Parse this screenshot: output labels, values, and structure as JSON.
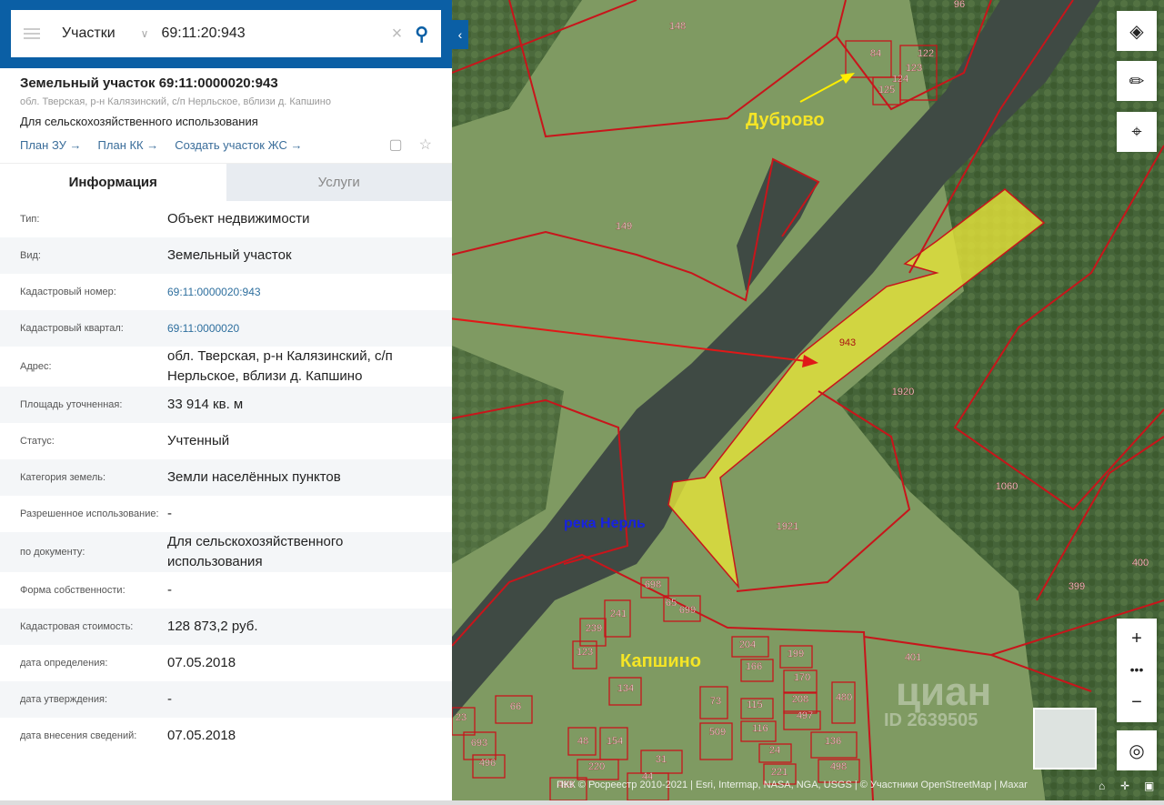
{
  "search": {
    "category": "Участки",
    "query": "69:11:20:943"
  },
  "object": {
    "title": "Земельный участок 69:11:0000020:943",
    "address": "обл. Тверская, р-н Калязинский, с/п Нерльское, вблизи д. Капшино",
    "purpose": "Для сельскохозяйственного использования",
    "links": [
      "План ЗУ →",
      "План КК →",
      "Создать участок ЖС →"
    ]
  },
  "tabs": [
    "Информация",
    "Услуги"
  ],
  "rows": [
    {
      "k": "Тип:",
      "v": "Объект недвижимости"
    },
    {
      "k": "Вид:",
      "v": "Земельный участок"
    },
    {
      "k": "Кадастровый номер:",
      "v": "69:11:0000020:943",
      "link": true
    },
    {
      "k": "Кадастровый квартал:",
      "v": "69:11:0000020",
      "link": true
    },
    {
      "k": "Адрес:",
      "v": "обл. Тверская, р-н Калязинский, с/п Нерльское, вблизи д. Капшино"
    },
    {
      "k": "Площадь уточненная:",
      "v": "33 914 кв. м"
    },
    {
      "k": "Статус:",
      "v": "Учтенный"
    },
    {
      "k": "Категория земель:",
      "v": "Земли населённых пунктов"
    },
    {
      "k": "Разрешенное использование:",
      "v": "-"
    },
    {
      "k": "по документу:",
      "v": "Для сельскохозяйственного использования"
    },
    {
      "k": "Форма собственности:",
      "v": "-"
    },
    {
      "k": "Кадастровая стоимость:",
      "v": "128 873,2 руб."
    },
    {
      "k": "дата определения:",
      "v": "07.05.2018"
    },
    {
      "k": "дата утверждения:",
      "v": "-"
    },
    {
      "k": "дата внесения сведений:",
      "v": "07.05.2018"
    }
  ],
  "map": {
    "labels": {
      "dubrovo": "Дуброво",
      "river": "река Нерль",
      "kapshino": "Капшино",
      "watermark": "циан",
      "watermark_id": "ID 2639505"
    },
    "parcels": [
      [
        "96",
        1055,
        8
      ],
      [
        "148",
        745,
        32
      ],
      [
        "84",
        963,
        62
      ],
      [
        "122",
        1018,
        62
      ],
      [
        "123",
        1005,
        78
      ],
      [
        "124",
        990,
        90
      ],
      [
        "125",
        975,
        102
      ],
      [
        "149",
        686,
        252
      ],
      [
        "943",
        932,
        380
      ],
      [
        "1920",
        993,
        434
      ],
      [
        "1060",
        1107,
        538
      ],
      [
        "1921",
        866,
        582
      ],
      [
        "400",
        1254,
        622
      ],
      [
        "399",
        1184,
        648
      ],
      [
        "401",
        1004,
        726
      ],
      [
        "698",
        718,
        646
      ],
      [
        "65",
        738,
        666
      ],
      [
        "699",
        756,
        674
      ],
      [
        "241",
        680,
        678
      ],
      [
        "239",
        653,
        694
      ],
      [
        "123",
        643,
        720
      ],
      [
        "204",
        822,
        712
      ],
      [
        "199",
        875,
        722
      ],
      [
        "166",
        829,
        736
      ],
      [
        "170",
        882,
        748
      ],
      [
        "208",
        880,
        772
      ],
      [
        "497",
        885,
        790
      ],
      [
        "115",
        830,
        778
      ],
      [
        "116",
        836,
        804
      ],
      [
        "24",
        852,
        828
      ],
      [
        "221",
        857,
        852
      ],
      [
        "136",
        916,
        818
      ],
      [
        "498",
        922,
        846
      ],
      [
        "480",
        928,
        770
      ],
      [
        "73",
        787,
        774
      ],
      [
        "509",
        789,
        808
      ],
      [
        "134",
        688,
        760
      ],
      [
        "66",
        567,
        780
      ],
      [
        "23",
        507,
        792
      ],
      [
        "693",
        527,
        820
      ],
      [
        "496",
        536,
        842
      ],
      [
        "48",
        641,
        818
      ],
      [
        "154",
        676,
        818
      ],
      [
        "220",
        656,
        846
      ],
      [
        "31",
        727,
        838
      ],
      [
        "44",
        712,
        857
      ],
      [
        "499",
        622,
        866
      ]
    ],
    "colors": {
      "parcel_border": "#c8151b",
      "selected_fill": "#e6e43a",
      "river": "#3f4a44"
    }
  },
  "attribution": "ПКК © Росреестр 2010-2021 | Esri, Intermap, NASA, NGA, USGS | © Участники OpenStreetMap | Maxar"
}
